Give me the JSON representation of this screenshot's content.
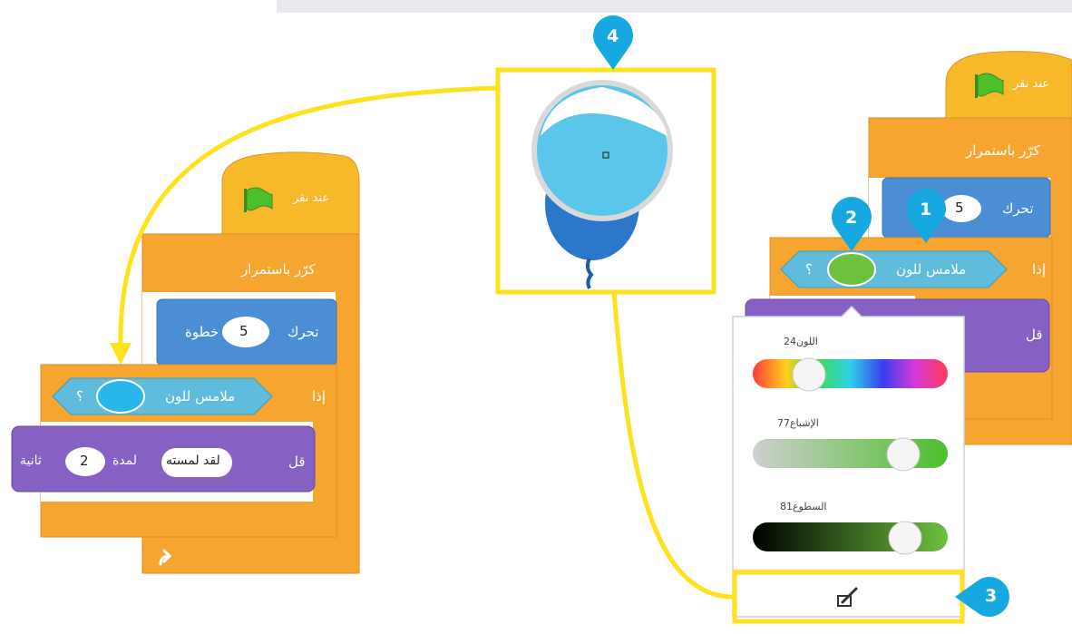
{
  "colors": {
    "event": "#f7b92a",
    "control": "#f6a530",
    "motion": "#4c8ed6",
    "sensing": "#5fbcdc",
    "looks": "#8661c3",
    "highlight": "#fde21d",
    "marker": "#16a9e1"
  },
  "left_script": {
    "when_flag": "عند نقر",
    "forever": "كرّر باستمرار",
    "move": {
      "label": "تحرك",
      "value": "5",
      "unit": "خطوة"
    },
    "if": {
      "label": "إذا",
      "touching": "ملامس للون",
      "q": "؟",
      "swatch_color": "#27b7ea"
    },
    "say": {
      "label": "قل",
      "message": "لقد لمسته",
      "for_label": "لمدة",
      "seconds": "2",
      "unit": "ثانية"
    }
  },
  "right_script": {
    "when_flag": "عند نقر",
    "forever": "كرّر باستمرار",
    "move": {
      "label": "تحرك",
      "value": "5",
      "unit": "خطوة"
    },
    "if": {
      "label": "إذا",
      "touching": "ملامس للون",
      "q": "؟",
      "swatch_color": "#6ec13f"
    },
    "say": {
      "label": "قل"
    }
  },
  "color_picker": {
    "color": {
      "label": "اللون",
      "value": "24"
    },
    "saturation": {
      "label": "الإشباع",
      "value": "77"
    },
    "brightness": {
      "label": "السطوع",
      "value": "81"
    },
    "eyedropper": "eyedropper-icon"
  },
  "markers": [
    "1",
    "2",
    "3",
    "4"
  ]
}
